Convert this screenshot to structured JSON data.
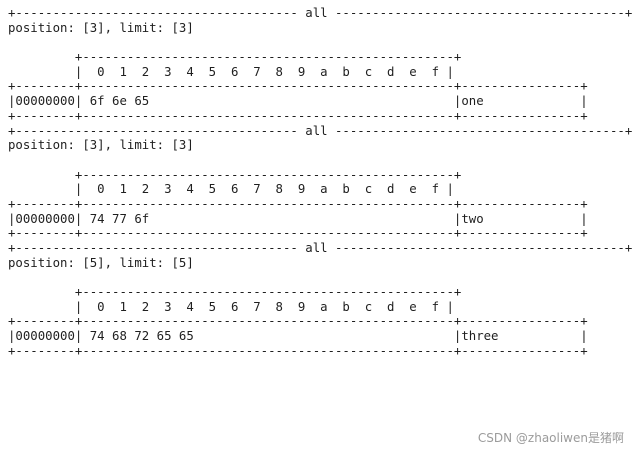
{
  "console": {
    "blocks": [
      {
        "lines": [
          "+-------------------------------------- all ---------------------------------------+",
          "position: [3], limit: [3]",
          "",
          "         +--------------------------------------------------+",
          "         |  0  1  2  3  4  5  6  7  8  9  a  b  c  d  e  f |",
          "+--------+--------------------------------------------------+----------------+",
          "|00000000| 6f 6e 65                                         |one             |",
          "+--------+--------------------------------------------------+----------------+"
        ]
      },
      {
        "lines": [
          "+-------------------------------------- all ---------------------------------------+",
          "position: [3], limit: [3]",
          "",
          "         +--------------------------------------------------+",
          "         |  0  1  2  3  4  5  6  7  8  9  a  b  c  d  e  f |",
          "+--------+--------------------------------------------------+----------------+",
          "|00000000| 74 77 6f                                         |two             |",
          "+--------+--------------------------------------------------+----------------+"
        ]
      },
      {
        "lines": [
          "+-------------------------------------- all ---------------------------------------+",
          "position: [5], limit: [5]",
          "",
          "         +--------------------------------------------------+",
          "         |  0  1  2  3  4  5  6  7  8  9  a  b  c  d  e  f |",
          "+--------+--------------------------------------------------+----------------+",
          "|00000000| 74 68 72 65 65                                   |three           |",
          "+--------+--------------------------------------------------+----------------+"
        ]
      }
    ]
  },
  "watermark": "CSDN @zhaoliwen是猪啊"
}
